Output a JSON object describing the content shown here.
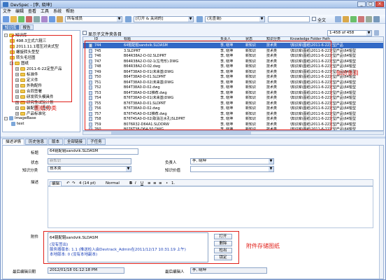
{
  "window": {
    "title": "DevSpec - [李, 晓坤]"
  },
  "menu": [
    "文件",
    "编辑",
    "查看",
    "工具",
    "系统",
    "帮助"
  ],
  "toolbar": {
    "scope": "所有成员",
    "field_filter": "[打开 & 关闭的]",
    "owner_filter": "(无查询)",
    "fulltext_label": "全文"
  },
  "left_tabs": [
    "知识库",
    "报告"
  ],
  "tree": {
    "root": "知识库",
    "items": [
      "498.3立式六辊三",
      "2011.11.1增压对夹式型",
      "螺旋转头型型",
      "转头毛坯图",
      "图纸",
      "2011-6-22定型产品",
      "标准件",
      "定义件",
      "外购配件",
      "合同签署",
      "研发转头模具件",
      "研究性试验计划",
      "装配图（图纸）",
      "产品标准化",
      "ImageBase",
      "test"
    ]
  },
  "list_header": {
    "show_subfolders": "显示子文件夹条目",
    "counter": "1-458 of 458"
  },
  "columns": [
    "ID",
    "标题",
    "负责人",
    "状态",
    "知识分类",
    "Knowledge Folder Path"
  ],
  "rows": [
    {
      "id": "744",
      "title": "64辊配辊sandvik.SLDASM",
      "owner": "李, 晓坤",
      "status": "新知识",
      "category": "技术类",
      "path": "\\知识库\\图纸\\2011-6-22定型产品"
    },
    {
      "id": "745",
      "title": "3.SLDPRT",
      "owner": "李, 晓坤",
      "status": "新知识",
      "category": "技术类",
      "path": "\\知识库\\图纸\\2011-6-22定型产品\\64辊型"
    },
    {
      "id": "746",
      "title": "B64R38A2-D-02.SLDPRT",
      "owner": "李, 晓坤",
      "status": "新知识",
      "category": "技术类",
      "path": "\\知识库\\图纸\\2011-6-22定型产品\\64辊型"
    },
    {
      "id": "747",
      "title": "B64R38A2-D-02-1(左弯形).DWG",
      "owner": "李, 晓坤",
      "status": "新知识",
      "category": "技术类",
      "path": "\\知识库\\图纸\\2011-6-22定型产品\\64辊型"
    },
    {
      "id": "748",
      "title": "B64R38A2-D-02.dwg",
      "owner": "李, 晓坤",
      "status": "新知识",
      "category": "技术类",
      "path": "\\知识库\\图纸\\2011-6-22定型产品\\64辊型"
    },
    {
      "id": "749",
      "title": "B64T38A0-D-01(未来基)DWG",
      "owner": "李, 晓坤",
      "status": "新知识",
      "category": "技术类",
      "path": "\\知识库\\图纸\\2011-6-22定型产品\\64辊型"
    },
    {
      "id": "750",
      "title": "B64T38A0-D-01.SLDPRT",
      "owner": "李, 晓坤",
      "status": "新知识",
      "category": "技术类",
      "path": "\\知识库\\图纸\\2011-6-22定型产品\\64辊型"
    },
    {
      "id": "751",
      "title": "B64T38A0-D-02(未来基)DWG",
      "owner": "李, 晓坤",
      "status": "新知识",
      "category": "技术类",
      "path": "\\知识库\\图纸\\2011-6-22定型产品\\64辊型"
    },
    {
      "id": "752",
      "title": "B64T38A0-D-02.dwg",
      "owner": "李, 晓坤",
      "status": "新知识",
      "category": "技术类",
      "path": "\\知识库\\图纸\\2011-6-22定型产品\\64辊型"
    },
    {
      "id": "753",
      "title": "B64T38A0-D-02推荐.dwg",
      "owner": "李, 晓坤",
      "status": "新知识",
      "category": "技术类",
      "path": "\\知识库\\图纸\\2011-6-22定型产品\\64辊型"
    },
    {
      "id": "754",
      "title": "B76T38A0-D-01(未来基)DWG",
      "owner": "李, 晓坤",
      "status": "新知识",
      "category": "技术类",
      "path": "\\知识库\\图纸\\2011-6-22定型产品\\64辊型"
    },
    {
      "id": "755",
      "title": "B76T38A0-D-01.SLDPRT",
      "owner": "李, 晓坤",
      "status": "新知识",
      "category": "技术类",
      "path": "\\知识库\\图纸\\2011-6-22定型产品\\64辊型"
    },
    {
      "id": "756",
      "title": "B76T38A0-D-02.dwg",
      "owner": "李, 晓坤",
      "status": "新知识",
      "category": "技术类",
      "path": "\\知识库\\图纸\\2011-6-22定型产品\\64辊型"
    },
    {
      "id": "757",
      "title": "B76T45A0-D-02推荐.dwg",
      "owner": "李, 晓坤",
      "status": "新知识",
      "category": "技术类",
      "path": "\\知识库\\图纸\\2011-6-22定型产品\\64辊型"
    },
    {
      "id": "758",
      "title": "B76T45A0-D-02(取消注水孔)SLDPRT",
      "owner": "李, 晓坤",
      "status": "新知识",
      "category": "技术类",
      "path": "\\知识库\\图纸\\2011-6-22定型产品\\64辊型"
    },
    {
      "id": "759",
      "title": "B076R32-D64A1.SLDDRW",
      "owner": "李, 晓坤",
      "status": "新知识",
      "category": "技术类",
      "path": "\\知识库\\图纸\\2011-6-22定型产品\\64辊型"
    },
    {
      "id": "760",
      "title": "B076T38-D64-50.DWG",
      "owner": "李, 晓坤",
      "status": "新知识",
      "category": "技术类",
      "path": "\\知识库\\图纸\\2011-6-22定型产品\\64辊型"
    }
  ],
  "annotations": {
    "tree": "图纸分类",
    "list": "知识条目",
    "attachment": "附件存储图纸"
  },
  "detail_tabs": [
    "描述详情",
    "历史信息",
    "版本",
    "全部链接",
    "子任务"
  ],
  "detail": {
    "title_label": "标题",
    "title_value": "64辊配辊sandvik.SLDASM",
    "status_label": "状态",
    "status_value": "新知识",
    "owner_label": "负责人",
    "owner_value": "李, 晓坤",
    "category_label": "知识分类",
    "category_value": "技术类",
    "value_label": "知识价值",
    "desc_label": "描述",
    "editor_font_size": "4 (14 pt)",
    "editor_style": "Normal",
    "editor_btn": "编辑",
    "attachment_label": "附件",
    "attachment_file": "64辊配辊sandvik.SLDASM",
    "attachment_line1": "(没有签出)",
    "attachment_line2": "服务器版本: 1.1 (推送检入由Devtrack_Admin在2011/12/17 10:31:19 上午)",
    "attachment_line3": "本地版本: 0 (没有本地副本)",
    "btn_open": "打开",
    "btn_delete": "删除",
    "btn_checkout": "检出",
    "btn_lock": "锁定",
    "last_edit_date_label": "最后编辑日期",
    "last_edit_date_value": "2012/01/18 01:12:18 PM",
    "last_editor_label": "最后编辑人",
    "last_editor_value": "李, 晓坤"
  },
  "colors": {
    "accent": "#3169c6",
    "annotation": "#e0201a"
  }
}
